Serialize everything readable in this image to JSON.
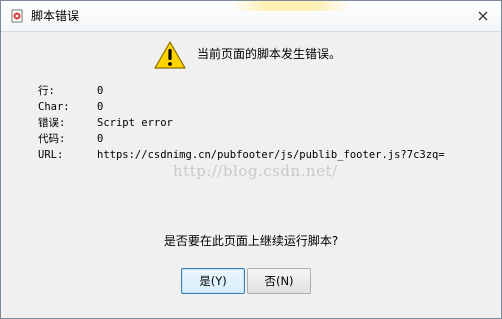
{
  "window": {
    "title": "脚本错误"
  },
  "message": {
    "headline": "当前页面的脚本发生错误。",
    "details": [
      {
        "label": "行:",
        "value": "0"
      },
      {
        "label": "Char:",
        "value": "0"
      },
      {
        "label": "错误:",
        "value": "Script error"
      },
      {
        "label": "代码:",
        "value": "0"
      },
      {
        "label": "URL:",
        "value": "https://csdnimg.cn/pubfooter/js/publib_footer.js?7c3zq="
      }
    ],
    "question": "是否要在此页面上继续运行脚本?"
  },
  "watermark": "http://blog.csdn.net/",
  "buttons": {
    "yes": "是(Y)",
    "no": "否(N)"
  },
  "colors": {
    "warning_fill": "#ffd400",
    "window_bg": "#f0f0f0",
    "default_button_border": "#3c7fb1"
  },
  "icons": {
    "title": "error-page-icon",
    "warning": "warning-triangle-icon",
    "close": "close-icon"
  }
}
